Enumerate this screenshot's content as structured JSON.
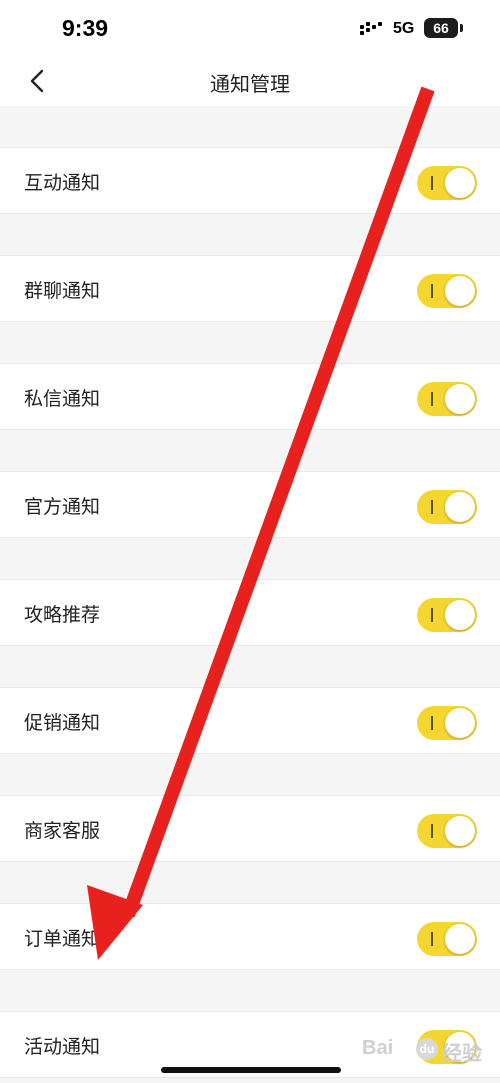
{
  "status_bar": {
    "time": "9:39",
    "network": "5G",
    "battery": "66"
  },
  "nav": {
    "back_icon": "chevron-left-icon",
    "title": "通知管理"
  },
  "settings": [
    {
      "label": "互动通知",
      "enabled": true
    },
    {
      "label": "群聊通知",
      "enabled": true
    },
    {
      "label": "私信通知",
      "enabled": true
    },
    {
      "label": "官方通知",
      "enabled": true
    },
    {
      "label": "攻略推荐",
      "enabled": true
    },
    {
      "label": "促销通知",
      "enabled": true
    },
    {
      "label": "商家客服",
      "enabled": true
    },
    {
      "label": "订单通知",
      "enabled": true
    },
    {
      "label": "活动通知",
      "enabled": true
    }
  ],
  "colors": {
    "toggle_on": "#f5d631",
    "annotation_arrow": "#e8211e"
  },
  "watermark": {
    "left": "Bai",
    "paw": "du",
    "right": "经验"
  }
}
